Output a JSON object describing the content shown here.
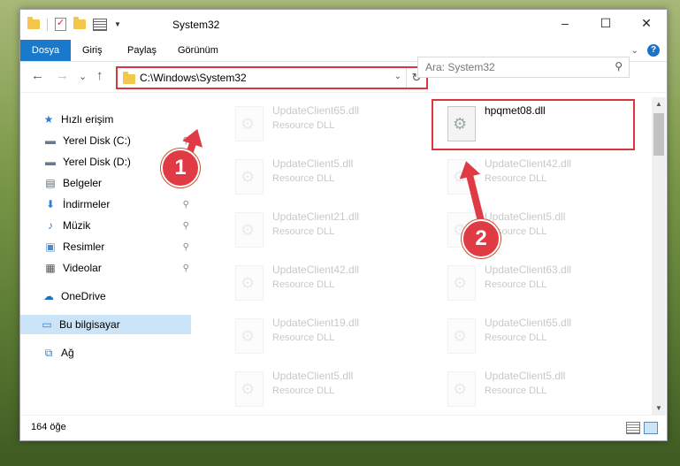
{
  "window": {
    "title": "System32",
    "controls": {
      "minimize": "–",
      "maximize": "☐",
      "close": "✕"
    }
  },
  "ribbon": {
    "tabs": [
      {
        "label": "Dosya"
      },
      {
        "label": "Giriş"
      },
      {
        "label": "Paylaş"
      },
      {
        "label": "Görünüm"
      }
    ],
    "help_label": "?"
  },
  "navbar": {
    "back": "←",
    "forward": "→",
    "recent": "⌄",
    "up": "↑",
    "address": "C:\\Windows\\System32",
    "search_placeholder": "Ara: System32"
  },
  "sidebar": {
    "items": [
      {
        "label": "Hızlı erişim",
        "icon": "star-icon",
        "glyph": "★",
        "color": "#2e7fd2",
        "pinned": false
      },
      {
        "label": "Yerel Disk (C:)",
        "icon": "drive-icon",
        "glyph": "▬",
        "color": "#6a7a88",
        "pinned": true
      },
      {
        "label": "Yerel Disk (D:)",
        "icon": "drive-icon",
        "glyph": "▬",
        "color": "#6a7a88",
        "pinned": true
      },
      {
        "label": "Belgeler",
        "icon": "document-icon",
        "glyph": "▤",
        "color": "#5a6a78",
        "pinned": true
      },
      {
        "label": "İndirmeler",
        "icon": "download-icon",
        "glyph": "⬇",
        "color": "#2e7fd2",
        "pinned": true
      },
      {
        "label": "Müzik",
        "icon": "music-icon",
        "glyph": "♪",
        "color": "#2e7fd2",
        "pinned": true
      },
      {
        "label": "Resimler",
        "icon": "picture-icon",
        "glyph": "▣",
        "color": "#4a8ac8",
        "pinned": true
      },
      {
        "label": "Videolar",
        "icon": "video-icon",
        "glyph": "▦",
        "color": "#555555",
        "pinned": true
      },
      {
        "label": "OneDrive",
        "icon": "cloud-icon",
        "glyph": "☁",
        "color": "#1a73c8",
        "pinned": false
      },
      {
        "label": "Bu bilgisayar",
        "icon": "computer-icon",
        "glyph": "▭",
        "color": "#2e7fd2",
        "pinned": false
      },
      {
        "label": "Ağ",
        "icon": "network-icon",
        "glyph": "⧉",
        "color": "#2e7fd2",
        "pinned": false
      }
    ],
    "pin_glyph": "📌"
  },
  "files": [
    {
      "name": "UpdateClient65.dll",
      "type": "Resource DLL"
    },
    {
      "name": "hpqmet08.dll",
      "type": ""
    },
    {
      "name": "UpdateClient5.dll",
      "type": "Resource DLL"
    },
    {
      "name": "UpdateClient42.dll",
      "type": "Resource DLL"
    },
    {
      "name": "UpdateClient21.dll",
      "type": "Resource DLL"
    },
    {
      "name": "UpdateClient5.dll",
      "type": "Resource DLL"
    },
    {
      "name": "UpdateClient42.dll",
      "type": "Resource DLL"
    },
    {
      "name": "UpdateClient63.dll",
      "type": "Resource DLL"
    },
    {
      "name": "UpdateClient19.dll",
      "type": "Resource DLL"
    },
    {
      "name": "UpdateClient65.dll",
      "type": "Resource DLL"
    },
    {
      "name": "UpdateClient5.dll",
      "type": "Resource DLL"
    },
    {
      "name": "UpdateClient5.dll",
      "type": "Resource DLL"
    }
  ],
  "status": {
    "count": "164 öğe"
  },
  "annotations": {
    "step1": "1",
    "step2": "2"
  },
  "colors": {
    "accent": "#1979ca",
    "highlight": "#d9363e",
    "annotation": "#e03a44",
    "selected": "#cce4f7"
  }
}
